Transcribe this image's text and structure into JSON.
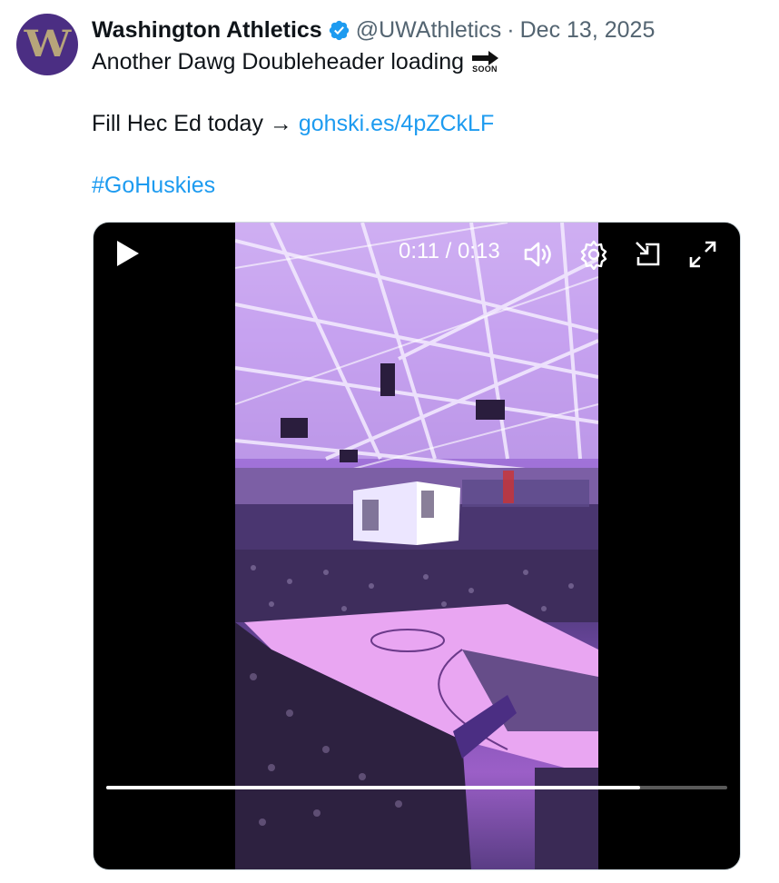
{
  "author": {
    "display_name": "Washington Athletics",
    "handle": "@UWAthletics",
    "separator": "·",
    "date": "Dec 13, 2025",
    "avatar_letter": "W",
    "avatar_color": "#4b2e83",
    "verified_icon": "verified-badge-icon"
  },
  "tweet": {
    "line1": "Another Dawg Doubleheader loading",
    "emoji_text": "SOON",
    "line2_text": "Fill Hec Ed today → ",
    "line2_link": "gohski.es/4pZCkLF",
    "hashtag": "#GoHuskies",
    "link_color": "#1d9bf0"
  },
  "video": {
    "current_time": "0:11",
    "time_separator": " / ",
    "duration": "0:13",
    "progress": 0.86,
    "controls": [
      "play-icon",
      "volume-icon",
      "settings-icon",
      "pip-icon",
      "fullscreen-icon"
    ]
  }
}
